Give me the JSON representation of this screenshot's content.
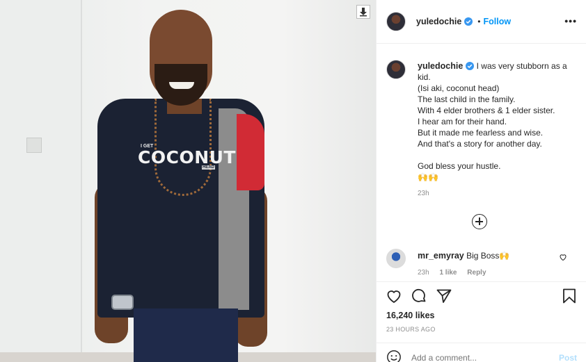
{
  "post": {
    "username": "yuledochie",
    "follow_label": "Follow",
    "more_icon": "more-icon",
    "caption_lines": [
      "I was very stubborn as a",
      "kid.",
      "(Isi aki, coconut head)",
      "The last child in the family.",
      "With 4 elder brothers & 1 elder sister.",
      "I hear am for their hand.",
      "But it made me fearless and wise.",
      "And that's a story for another day.",
      "",
      "God bless your hustle.",
      "🙌🙌"
    ],
    "caption_time": "23h",
    "likes": "16,240 likes",
    "posted_ago": "23 HOURS AGO"
  },
  "photo": {
    "shirt_small_top": "I GET",
    "shirt_big": "COCONUT",
    "shirt_small_tag": "HEAD"
  },
  "comments": [
    {
      "username": "mr_emyray",
      "text": "Big Boss🙌",
      "time": "23h",
      "likes": "1 like",
      "reply_label": "Reply"
    }
  ],
  "add_comment": {
    "placeholder": "Add a comment...",
    "post_label": "Post"
  },
  "colors": {
    "accent": "#0095f6",
    "verified": "#3897f0",
    "post_disabled": "#b2dffc"
  }
}
